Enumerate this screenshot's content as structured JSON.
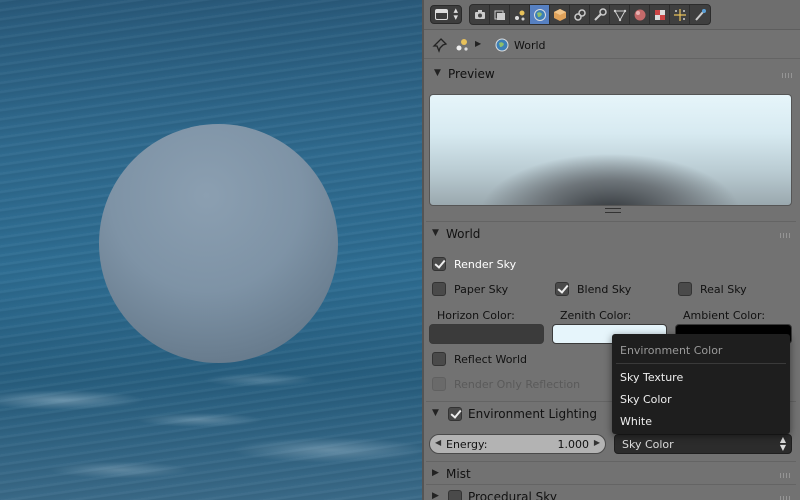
{
  "header": {
    "editor_type": "properties-editor",
    "context_tabs": [
      "render-icon",
      "render-layers-icon",
      "scene-icon",
      "world-icon",
      "object-icon",
      "constraints-icon",
      "modifiers-icon",
      "data-icon",
      "material-icon",
      "texture-icon",
      "particles-icon",
      "physics-icon"
    ],
    "active_tab": "world-icon"
  },
  "breadcrumb": {
    "label": "World"
  },
  "preview": {
    "title": "Preview"
  },
  "world": {
    "title": "World",
    "render_sky": "Render Sky",
    "paper_sky": "Paper Sky",
    "blend_sky": "Blend Sky",
    "real_sky": "Real Sky",
    "horizon_label": "Horizon Color:",
    "zenith_label": "Zenith Color:",
    "ambient_label": "Ambient Color:",
    "horizon_color": "#3b3b3b",
    "zenith_color": "#e6f5fb",
    "ambient_color": "#000000",
    "reflect_world": "Reflect World",
    "render_only_reflection": "Render Only Reflection"
  },
  "env_lighting": {
    "title": "Environment Lighting",
    "energy_label": "Energy:",
    "energy_value": "1.000",
    "env_color_value": "Sky Color"
  },
  "dropdown": {
    "title": "Environment Color",
    "items": [
      "Sky Texture",
      "Sky Color",
      "White"
    ]
  },
  "mist": {
    "title": "Mist"
  },
  "procedural_sky": {
    "title": "Procedural Sky"
  }
}
